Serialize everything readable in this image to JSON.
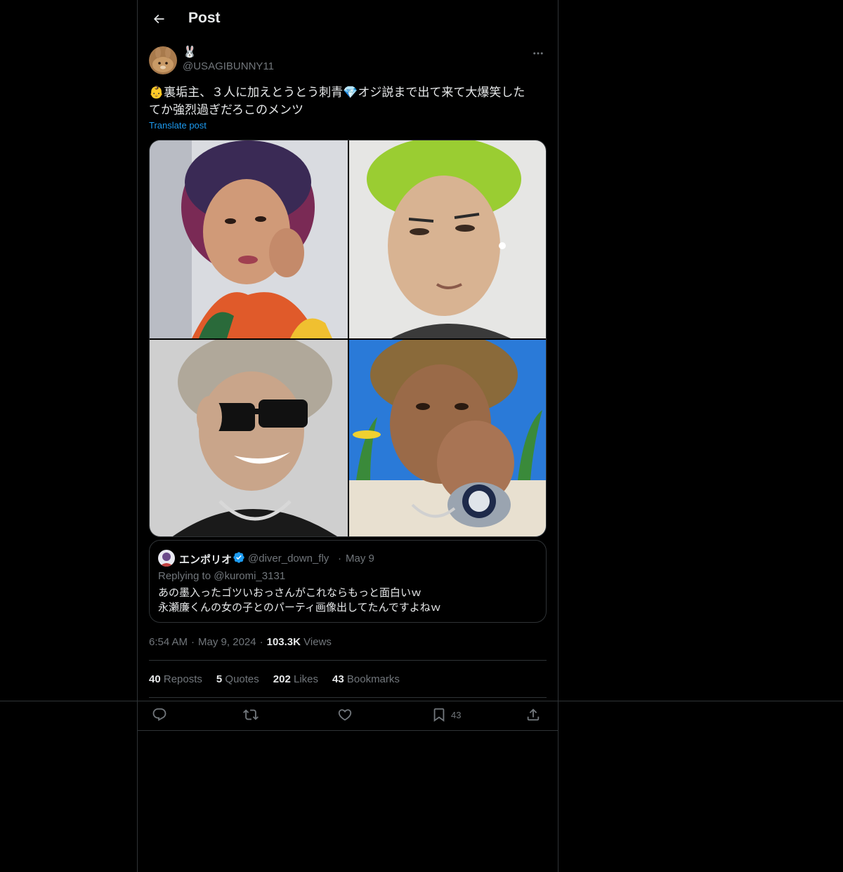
{
  "header": {
    "title": "Post"
  },
  "author": {
    "display_name": "🐰",
    "handle": "@USAGIBUNNY11"
  },
  "post": {
    "text": "👶裏垢主、３人に加えとうとう刺青💎オジ説まで出て来て大爆笑した\nてか強烈過ぎだろこのメンツ",
    "translate_label": "Translate post"
  },
  "quote": {
    "name": "エンポリオ",
    "handle": "@diver_down_fly",
    "separator": "·",
    "date": "May 9",
    "reply_prefix": "Replying to ",
    "reply_to": "@kuromi_3131",
    "text": "あの墨入ったゴツいおっさんがこれならもっと面白いｗ\n永瀬廉くんの女の子とのパーティ画像出してたんですよねｗ"
  },
  "meta": {
    "time": "6:54 AM",
    "dot1": "·",
    "date": "May 9, 2024",
    "dot2": "·",
    "views_count": "103.3K",
    "views_label": "Views"
  },
  "stats": {
    "reposts_count": "40",
    "reposts_label": "Reposts",
    "quotes_count": "5",
    "quotes_label": "Quotes",
    "likes_count": "202",
    "likes_label": "Likes",
    "bookmarks_count": "43",
    "bookmarks_label": "Bookmarks"
  },
  "actions": {
    "bookmark_count": "43"
  },
  "icons": {
    "back": "arrow-left-icon",
    "more": "more-horizontal-icon",
    "verified": "verified-badge-icon",
    "reply": "reply-icon",
    "repost": "repost-icon",
    "like": "heart-icon",
    "bookmark": "bookmark-icon",
    "share": "share-icon"
  },
  "colors": {
    "background": "#000000",
    "border": "#2f3336",
    "text_primary": "#e7e9ea",
    "text_secondary": "#71767b",
    "link": "#1d9bf0"
  }
}
